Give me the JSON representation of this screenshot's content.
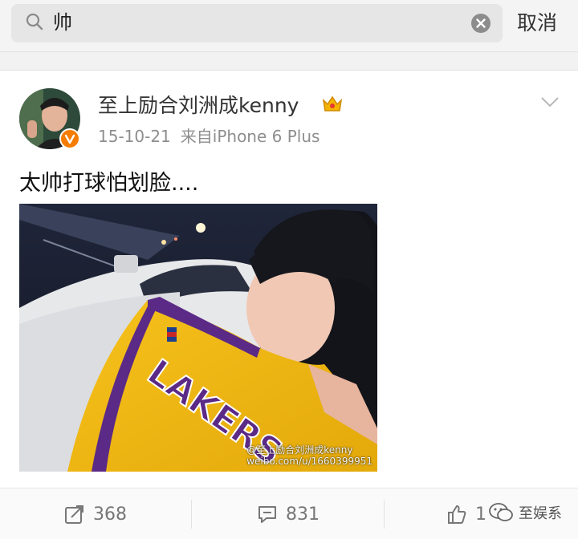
{
  "search": {
    "query": "帅",
    "cancel_label": "取消"
  },
  "post": {
    "author": "至上励合刘洲成kenny",
    "date": "15-10-21",
    "source": "来自iPhone 6 Plus",
    "text": "太帅打球怕划脸....",
    "photo": {
      "jersey_text": "LAKERS",
      "watermark_name": "@至上励合刘洲成kenny",
      "watermark_url": "weibo.com/u/1660399951"
    }
  },
  "actions": {
    "repost_count": "368",
    "comment_count": "831",
    "like_count": "1"
  },
  "overlay": {
    "channel_name": "至娱系"
  },
  "colors": {
    "search_bg": "#e6e6e6",
    "meta_gray": "#8e8e8e",
    "badge_orange": "#f57c00",
    "vip_gold": "#f4b400"
  }
}
